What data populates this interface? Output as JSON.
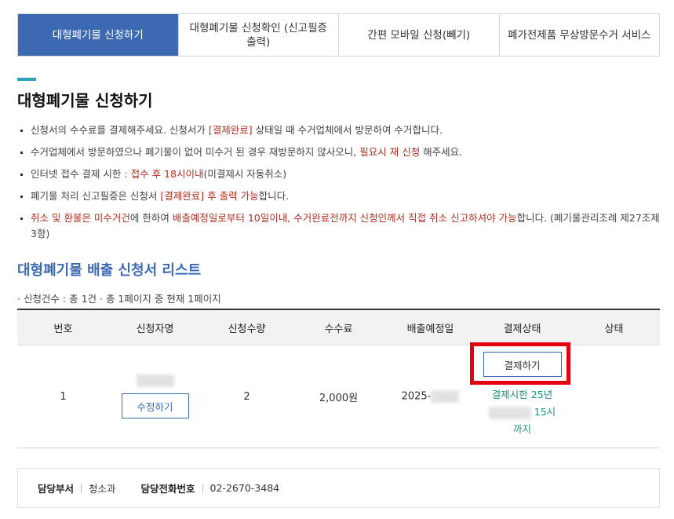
{
  "tabs": [
    {
      "label": "대형폐기물 신청하기"
    },
    {
      "label": "대형폐기물 신청확인 (신고필증 출력)"
    },
    {
      "label": "간편 모바일 신청(빼기)"
    },
    {
      "label": "폐가전제품 무상방문수거 서비스"
    }
  ],
  "page_title": "대형폐기물 신청하기",
  "notes": {
    "n1": {
      "a": "신청서의 수수료를 결제해주세요. 신청서가 ",
      "b": "[결제완료]",
      "c": " 상태일 때 수거업체에서 방문하여 수거합니다."
    },
    "n2": {
      "a": "수거업체에서 방문하였으나 폐기물이 없어 미수거 된 경우 재방문하지 않사오니, ",
      "b": "필요시 재 신청",
      "c": " 해주세요."
    },
    "n3": {
      "a": "인터넷 접수 결제 시한 : ",
      "b": "접수 후 18시이내",
      "c": "(미결제시 자동취소)"
    },
    "n4": {
      "a": "폐기물 처리 신고필증은 신청서 ",
      "b": "[결제완료] 후 출력 가능",
      "c": "합니다."
    },
    "n5": {
      "a": "취소 및 환불은 미수거건",
      "b": "에 한하여 ",
      "c": "배출예정일로부터 10일이내, 수거완료전까지 신청인께서 직접 취소 신고하셔야 가능",
      "d": "합니다. (폐기물관리조례 제27조제3항)"
    }
  },
  "list_title": "대형폐기물 배출 신청서 리스트",
  "count_text": "· 신청건수 : 총 1건 · 총 1페이지 중 현재 1페이지",
  "table": {
    "headers": [
      "번호",
      "신청자명",
      "신청수량",
      "수수료",
      "배출예정일",
      "결제상태",
      "상태"
    ],
    "row": {
      "no": "1",
      "edit_label": "수정하기",
      "quantity": "2",
      "fee": "2,000원",
      "date_prefix": "2025-",
      "pay_label": "결제하기",
      "deadline_line1": "결제시한 25년",
      "deadline_hour": "15시",
      "deadline_line3": "까지",
      "status": ""
    }
  },
  "footer": {
    "dept_label": "담당부서",
    "dept_value": "청소과",
    "phone_label": "담당전화번호",
    "phone_value": "02-2670-3484"
  },
  "colors": {
    "accent": "#3d69b3",
    "highlight": "#b22d1e",
    "teal": "#1f8f84",
    "annotation": "#e3000f"
  }
}
